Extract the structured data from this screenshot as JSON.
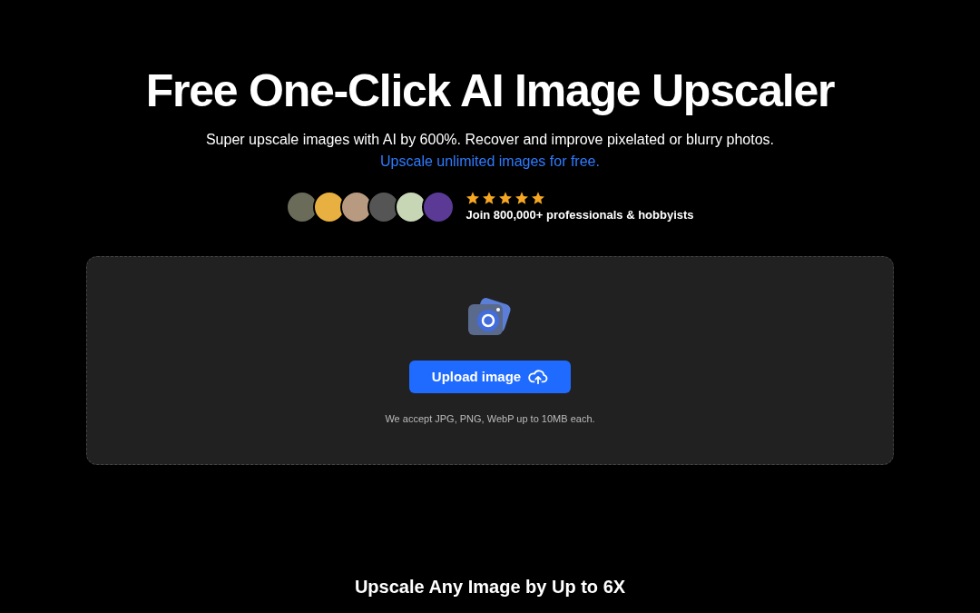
{
  "hero": {
    "title": "Free One-Click AI Image Upscaler",
    "subtitle": "Super upscale images with AI by 600%. Recover and improve pixelated or blurry photos.",
    "link": "Upscale unlimited images for free."
  },
  "social_proof": {
    "stars": 5,
    "caption": "Join 800,000+ professionals & hobbyists"
  },
  "upload": {
    "button": "Upload image",
    "note": "We accept JPG, PNG, WebP up to 10MB each."
  },
  "next_section": {
    "title": "Upscale Any Image by Up to 6X"
  }
}
